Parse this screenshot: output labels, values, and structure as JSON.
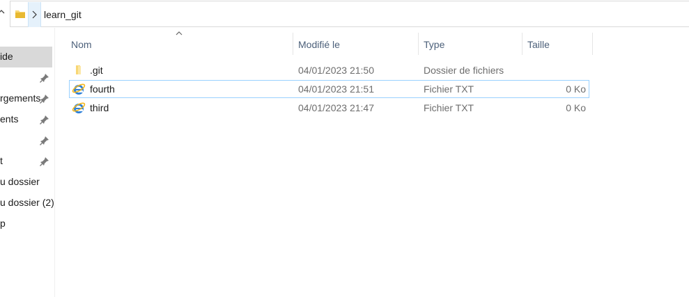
{
  "address_bar": {
    "path_segment": "learn_git"
  },
  "nav_pane": {
    "items": [
      {
        "label": "ide",
        "pinned": false,
        "selected": true
      },
      {
        "label": "",
        "pinned": true,
        "selected": false
      },
      {
        "label": "rgements",
        "pinned": true,
        "selected": false
      },
      {
        "label": "ents",
        "pinned": true,
        "selected": false
      },
      {
        "label": "",
        "pinned": true,
        "selected": false
      },
      {
        "label": "t",
        "pinned": true,
        "selected": false
      },
      {
        "label": "u dossier",
        "pinned": false,
        "selected": false
      },
      {
        "label": "u dossier (2)",
        "pinned": false,
        "selected": false
      },
      {
        "label": "p",
        "pinned": false,
        "selected": false
      }
    ]
  },
  "columns": {
    "name": "Nom",
    "modified": "Modifié le",
    "type": "Type",
    "size": "Taille"
  },
  "files": [
    {
      "name": ".git",
      "modified": "04/01/2023 21:50",
      "type": "Dossier de fichiers",
      "size": "",
      "icon": "folder-icon"
    },
    {
      "name": "fourth",
      "modified": "04/01/2023 21:51",
      "type": "Fichier TXT",
      "size": "0 Ko",
      "icon": "internet-explorer-icon"
    },
    {
      "name": "third",
      "modified": "04/01/2023 21:47",
      "type": "Fichier TXT",
      "size": "0 Ko",
      "icon": "internet-explorer-icon"
    }
  ],
  "colors": {
    "header_text": "#4c607a",
    "selection_outline": "#99d1ff",
    "nav_selected": "#d9d9d9",
    "folder": "#f8d775"
  }
}
